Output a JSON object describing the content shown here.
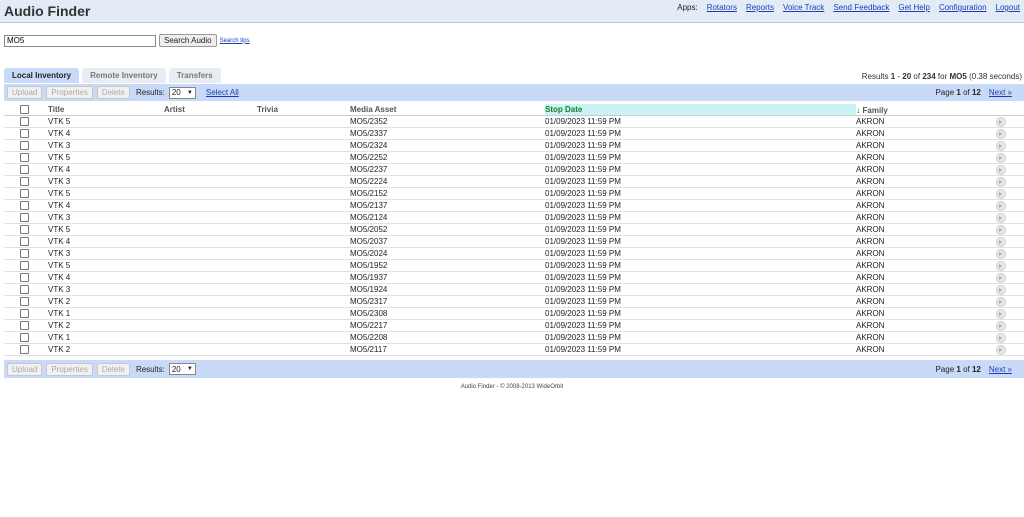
{
  "header": {
    "title": "Audio Finder",
    "apps_label": "Apps:",
    "links": [
      "Rotators",
      "Reports",
      "Voice Track",
      "Send Feedback",
      "Get Help",
      "Configuration",
      "Logout"
    ]
  },
  "search": {
    "value": "MO5",
    "button_label": "Search Audio",
    "tips_label": "Search tips"
  },
  "tabs": [
    "Local Inventory",
    "Remote Inventory",
    "Transfers"
  ],
  "results_summary": {
    "prefix": "Results",
    "from": "1",
    "dash": "-",
    "to": "20",
    "of_label": "of",
    "total": "234",
    "for_label": "for",
    "query": "MO5",
    "time": "(0.38 seconds)"
  },
  "toolbar": {
    "upload_label": "Upload",
    "properties_label": "Properties",
    "delete_label": "Delete",
    "results_label": "Results:",
    "results_per_page": "20",
    "select_all_label": "Select All",
    "page_label": "Page",
    "page_current": "1",
    "page_of_label": "of",
    "page_total": "12",
    "next_label": "Next »"
  },
  "table": {
    "columns": [
      "Title",
      "Artist",
      "Trivia",
      "Media Asset",
      "Stop Date",
      "Family"
    ],
    "sorted_column": "Stop Date",
    "rows": [
      {
        "title": "VTK 5",
        "artist": "",
        "trivia": "",
        "media_asset": "MO5/2352",
        "stop_date": "01/09/2023 11:59 PM",
        "family": "AKRON"
      },
      {
        "title": "VTK 4",
        "artist": "",
        "trivia": "",
        "media_asset": "MO5/2337",
        "stop_date": "01/09/2023 11:59 PM",
        "family": "AKRON"
      },
      {
        "title": "VTK 3",
        "artist": "",
        "trivia": "",
        "media_asset": "MO5/2324",
        "stop_date": "01/09/2023 11:59 PM",
        "family": "AKRON"
      },
      {
        "title": "VTK 5",
        "artist": "",
        "trivia": "",
        "media_asset": "MO5/2252",
        "stop_date": "01/09/2023 11:59 PM",
        "family": "AKRON"
      },
      {
        "title": "VTK 4",
        "artist": "",
        "trivia": "",
        "media_asset": "MO5/2237",
        "stop_date": "01/09/2023 11:59 PM",
        "family": "AKRON"
      },
      {
        "title": "VTK 3",
        "artist": "",
        "trivia": "",
        "media_asset": "MO5/2224",
        "stop_date": "01/09/2023 11:59 PM",
        "family": "AKRON"
      },
      {
        "title": "VTK 5",
        "artist": "",
        "trivia": "",
        "media_asset": "MO5/2152",
        "stop_date": "01/09/2023 11:59 PM",
        "family": "AKRON"
      },
      {
        "title": "VTK 4",
        "artist": "",
        "trivia": "",
        "media_asset": "MO5/2137",
        "stop_date": "01/09/2023 11:59 PM",
        "family": "AKRON"
      },
      {
        "title": "VTK 3",
        "artist": "",
        "trivia": "",
        "media_asset": "MO5/2124",
        "stop_date": "01/09/2023 11:59 PM",
        "family": "AKRON"
      },
      {
        "title": "VTK 5",
        "artist": "",
        "trivia": "",
        "media_asset": "MO5/2052",
        "stop_date": "01/09/2023 11:59 PM",
        "family": "AKRON"
      },
      {
        "title": "VTK 4",
        "artist": "",
        "trivia": "",
        "media_asset": "MO5/2037",
        "stop_date": "01/09/2023 11:59 PM",
        "family": "AKRON"
      },
      {
        "title": "VTK 3",
        "artist": "",
        "trivia": "",
        "media_asset": "MO5/2024",
        "stop_date": "01/09/2023 11:59 PM",
        "family": "AKRON"
      },
      {
        "title": "VTK 5",
        "artist": "",
        "trivia": "",
        "media_asset": "MO5/1952",
        "stop_date": "01/09/2023 11:59 PM",
        "family": "AKRON"
      },
      {
        "title": "VTK 4",
        "artist": "",
        "trivia": "",
        "media_asset": "MO5/1937",
        "stop_date": "01/09/2023 11:59 PM",
        "family": "AKRON"
      },
      {
        "title": "VTK 3",
        "artist": "",
        "trivia": "",
        "media_asset": "MO5/1924",
        "stop_date": "01/09/2023 11:59 PM",
        "family": "AKRON"
      },
      {
        "title": "VTK 2",
        "artist": "",
        "trivia": "",
        "media_asset": "MO5/2317",
        "stop_date": "01/09/2023 11:59 PM",
        "family": "AKRON"
      },
      {
        "title": "VTK 1",
        "artist": "",
        "trivia": "",
        "media_asset": "MO5/2308",
        "stop_date": "01/09/2023 11:59 PM",
        "family": "AKRON"
      },
      {
        "title": "VTK 2",
        "artist": "",
        "trivia": "",
        "media_asset": "MO5/2217",
        "stop_date": "01/09/2023 11:59 PM",
        "family": "AKRON"
      },
      {
        "title": "VTK 1",
        "artist": "",
        "trivia": "",
        "media_asset": "MO5/2208",
        "stop_date": "01/09/2023 11:59 PM",
        "family": "AKRON"
      },
      {
        "title": "VTK 2",
        "artist": "",
        "trivia": "",
        "media_asset": "MO5/2117",
        "stop_date": "01/09/2023 11:59 PM",
        "family": "AKRON"
      }
    ]
  },
  "footer": "Audio Finder - © 2008-2013 WideOrbit"
}
